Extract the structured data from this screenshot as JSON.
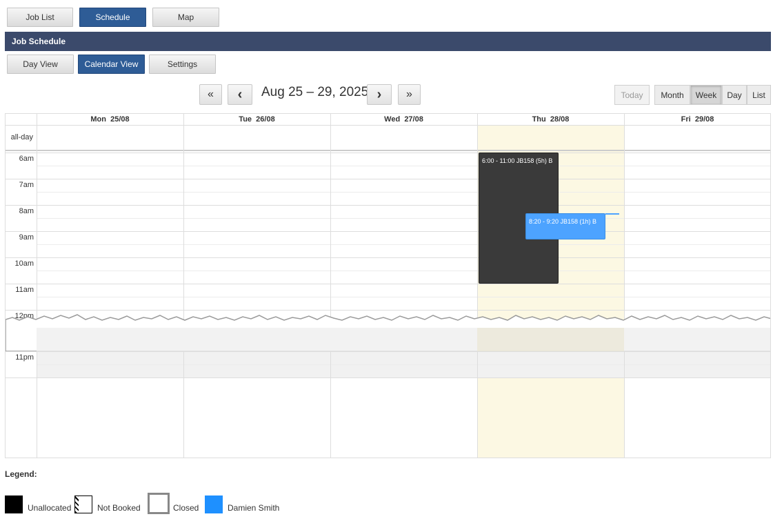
{
  "top_nav": {
    "job_list": "Job List",
    "schedule": "Schedule",
    "map": "Map"
  },
  "section_title": "Job Schedule",
  "sub_nav": {
    "day_view": "Day View",
    "calendar_view": "Calendar View",
    "settings": "Settings"
  },
  "toolbar": {
    "prev_prev": "«",
    "prev": "‹",
    "next": "›",
    "next_next": "»",
    "range_title": "Aug 25 – 29, 2025",
    "today": "Today",
    "views": {
      "month": "Month",
      "week": "Week",
      "day": "Day",
      "list": "List"
    },
    "selected_view": "Week"
  },
  "calendar": {
    "days": [
      {
        "dow": "Mon",
        "date": "25/08"
      },
      {
        "dow": "Tue",
        "date": "26/08"
      },
      {
        "dow": "Wed",
        "date": "27/08"
      },
      {
        "dow": "Thu",
        "date": "28/08"
      },
      {
        "dow": "Fri",
        "date": "29/08"
      }
    ],
    "allday_label": "all-day",
    "times": [
      "6am",
      "7am",
      "8am",
      "9am",
      "10am",
      "11am",
      "12pm"
    ],
    "late_time": "11pm",
    "today_index": 3,
    "events": [
      {
        "text": "6:00 - 11:00 JB158 (5h) B",
        "color": "#3a3a3a"
      },
      {
        "text": "8:20 - 9:20 JB158 (1h) B",
        "color": "#4da3ff"
      }
    ]
  },
  "legend": {
    "title": "Legend:",
    "items": [
      {
        "label": "Unallocated",
        "color": "#000000"
      },
      {
        "label": "Not Booked",
        "color": "#ffffff"
      },
      {
        "label": "Closed",
        "color": "#ffffff"
      },
      {
        "label": "Damien Smith",
        "color": "#1e90ff"
      }
    ]
  }
}
